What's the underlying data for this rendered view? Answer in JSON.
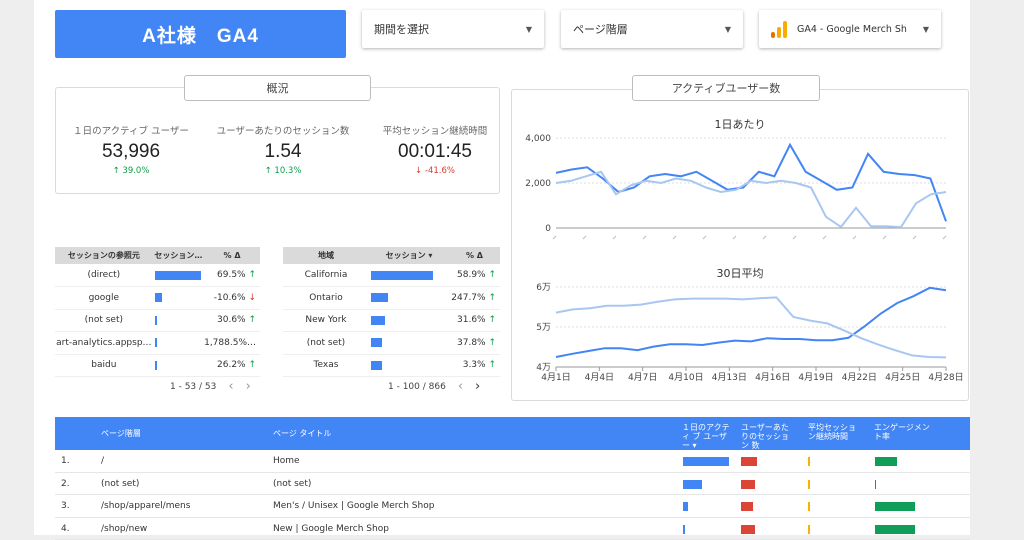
{
  "header": {
    "title": "A社様　GA4",
    "date_select": "期間を選択",
    "page_level": "ページ階層",
    "property": "GA4 - Google Merch Sh"
  },
  "overview": {
    "title": "概況",
    "kpis": [
      {
        "label": "１日のアクティブ ユーザー",
        "value": "53,996",
        "delta": "39.0%",
        "dir": "up"
      },
      {
        "label": "ユーザーあたりのセッション数",
        "value": "1.54",
        "delta": "10.3%",
        "dir": "up"
      },
      {
        "label": "平均セッション継続時間",
        "value": "00:01:45",
        "delta": "-41.6%",
        "dir": "down"
      }
    ]
  },
  "source_table": {
    "headers": [
      "セッションの参照元",
      "セッション…",
      "% Δ"
    ],
    "rows": [
      {
        "name": "(direct)",
        "bar": 1.0,
        "pct": "69.5%",
        "dir": "up"
      },
      {
        "name": "google",
        "bar": 0.15,
        "pct": "-10.6%",
        "dir": "down"
      },
      {
        "name": "(not set)",
        "bar": 0.02,
        "pct": "30.6%",
        "dir": "up"
      },
      {
        "name": "art-analytics.appsp…",
        "bar": 0.005,
        "pct": "1,788.5%…",
        "dir": ""
      },
      {
        "name": "baidu",
        "bar": 0.005,
        "pct": "26.2%",
        "dir": "up"
      }
    ],
    "pager": "1 - 53 / 53"
  },
  "region_table": {
    "headers": [
      "地域",
      "セッション ▾",
      "% Δ"
    ],
    "rows": [
      {
        "name": "California",
        "bar": 1.0,
        "pct": "58.9%",
        "dir": "up"
      },
      {
        "name": "Ontario",
        "bar": 0.27,
        "pct": "247.7%",
        "dir": "up"
      },
      {
        "name": "New York",
        "bar": 0.22,
        "pct": "31.6%",
        "dir": "up"
      },
      {
        "name": "(not set)",
        "bar": 0.18,
        "pct": "37.8%",
        "dir": "up"
      },
      {
        "name": "Texas",
        "bar": 0.17,
        "pct": "3.3%",
        "dir": "up"
      }
    ],
    "pager": "1 - 100 / 866"
  },
  "active_users": {
    "title": "アクティブユーザー数",
    "daily_title": "1日あたり",
    "avg_title": "30日平均"
  },
  "chart_data": [
    {
      "type": "line",
      "title": "1日あたり",
      "ylim": [
        0,
        4000
      ],
      "yticks": [
        "0",
        "2,000",
        "4,000"
      ],
      "grid": true,
      "series": [
        {
          "values": [
            2450,
            2600,
            2700,
            2200,
            1600,
            1800,
            2300,
            2400,
            2300,
            2500,
            2100,
            1700,
            1800,
            2500,
            2300,
            3700,
            2500,
            2100,
            1700,
            1800,
            3300,
            2500,
            2400,
            2350,
            2200,
            300
          ],
          "color": "#4285f4"
        },
        {
          "values": [
            2000,
            2100,
            2300,
            2500,
            1500,
            1900,
            2100,
            2000,
            2200,
            2100,
            1800,
            1600,
            1700,
            2100,
            2000,
            2100,
            2000,
            1800,
            500,
            50,
            900,
            80,
            80,
            40,
            1100,
            1500,
            1600
          ],
          "color": "#a8c7f0"
        }
      ]
    },
    {
      "type": "line",
      "title": "30日平均",
      "ylim": [
        40000,
        60000
      ],
      "yticks": [
        "4万",
        "5万",
        "6万"
      ],
      "xticks": [
        "4月1日",
        "4月4日",
        "4月7日",
        "4月10日",
        "4月13日",
        "4月16日",
        "4月19日",
        "4月22日",
        "4月25日",
        "4月28日"
      ],
      "grid": true,
      "series": [
        {
          "values": [
            42500,
            43300,
            44000,
            44700,
            44700,
            44200,
            45100,
            45700,
            45700,
            45500,
            46100,
            46600,
            46400,
            47200,
            47000,
            47000,
            46700,
            46700,
            47300,
            50200,
            53400,
            56000,
            57700,
            59800,
            59200
          ],
          "color": "#4285f4"
        },
        {
          "values": [
            53600,
            54400,
            54700,
            55300,
            55300,
            55600,
            56300,
            56900,
            57100,
            57100,
            57100,
            56900,
            57200,
            57400,
            52500,
            51600,
            50900,
            49100,
            47200,
            45600,
            44200,
            42900,
            42500,
            42400
          ],
          "color": "#a8c7f0"
        }
      ]
    }
  ],
  "page_table": {
    "headers": {
      "path": "ページ階層",
      "title": "ページ タイトル",
      "dau": "１日のアクティ ブ ユーザー ▾",
      "spu": "ユーザーあた りのセッション 数",
      "dur": "平均セッション継続時間",
      "eng": "エンゲージメン ト率"
    },
    "rows": [
      {
        "no": "1.",
        "path": "/",
        "title": "Home",
        "dau": 1.0,
        "spu": 1.0,
        "dur": 1.0,
        "eng": 1.0
      },
      {
        "no": "2.",
        "path": "(not set)",
        "title": "(not set)",
        "dau": 0.42,
        "spu": 0.85,
        "dur": 1.0,
        "eng": 0.05
      },
      {
        "no": "3.",
        "path": "/shop/apparel/mens",
        "title": "Men's / Unisex | Google Merch Shop",
        "dau": 0.1,
        "spu": 0.78,
        "dur": 1.0,
        "eng": 1.8
      },
      {
        "no": "4.",
        "path": "/shop/new",
        "title": "New | Google Merch Shop",
        "dau": 0.04,
        "spu": 0.85,
        "dur": 1.0,
        "eng": 1.8
      }
    ]
  },
  "colors": {
    "accent": "#4285f4",
    "up": "#0d9c4a",
    "down": "#d23c2e",
    "red_bar": "#db4437",
    "green_bar": "#0f9d58",
    "orange_bar": "#f4b400",
    "light_line": "#a8c7f0"
  }
}
